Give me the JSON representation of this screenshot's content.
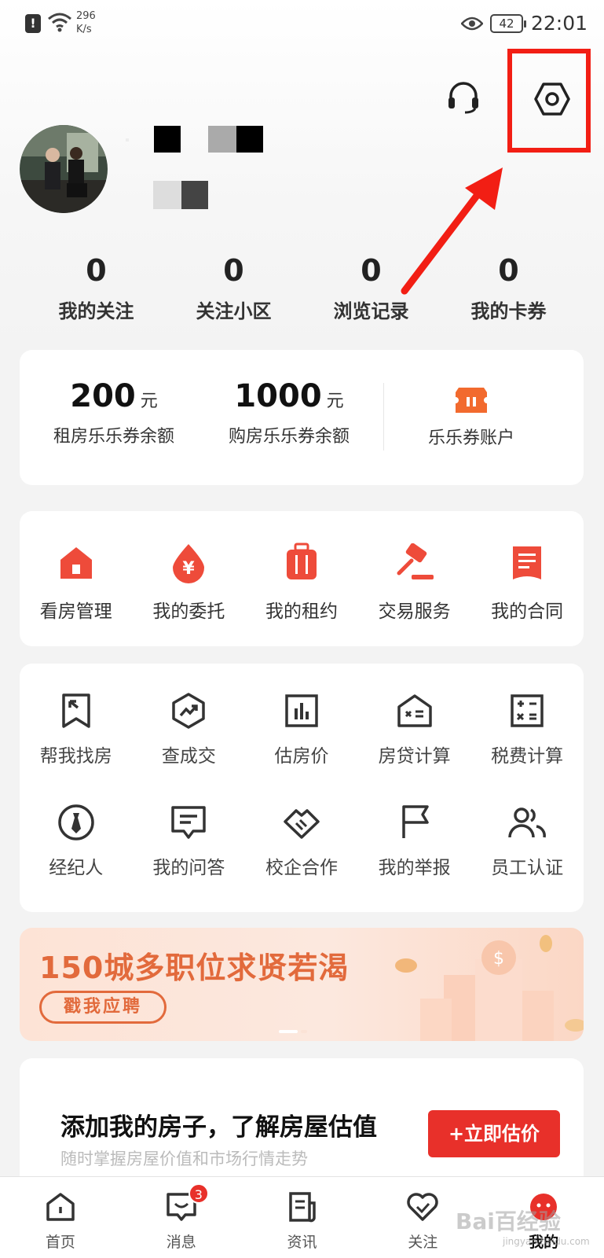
{
  "status_bar": {
    "network_speed": "296",
    "network_unit": "K/s",
    "battery": "42",
    "time": "22:01"
  },
  "header": {
    "support_icon": "headset-icon",
    "settings_icon": "hexagon-settings-icon"
  },
  "stats": [
    {
      "value": "0",
      "label": "我的关注"
    },
    {
      "value": "0",
      "label": "关注小区"
    },
    {
      "value": "0",
      "label": "浏览记录"
    },
    {
      "value": "0",
      "label": "我的卡券"
    }
  ],
  "coupons": {
    "rent": {
      "amount": "200",
      "unit": "元",
      "label": "租房乐乐券余额"
    },
    "buy": {
      "amount": "1000",
      "unit": "元",
      "label": "购房乐乐券余额"
    },
    "account": {
      "label": "乐乐券账户",
      "icon": "ticket-icon"
    }
  },
  "services": [
    {
      "label": "看房管理",
      "icon": "house-icon"
    },
    {
      "label": "我的委托",
      "icon": "yuan-drop-icon"
    },
    {
      "label": "我的租约",
      "icon": "luggage-icon"
    },
    {
      "label": "交易服务",
      "icon": "gavel-icon"
    },
    {
      "label": "我的合同",
      "icon": "contract-icon"
    }
  ],
  "tools": [
    {
      "label": "帮我找房",
      "icon": "flag-bookmark-icon"
    },
    {
      "label": "查成交",
      "icon": "trend-hexagon-icon"
    },
    {
      "label": "估房价",
      "icon": "bar-chart-icon"
    },
    {
      "label": "房贷计算",
      "icon": "house-calc-icon"
    },
    {
      "label": "税费计算",
      "icon": "calculator-icon"
    },
    {
      "label": "经纪人",
      "icon": "tie-icon"
    },
    {
      "label": "我的问答",
      "icon": "chat-icon"
    },
    {
      "label": "校企合作",
      "icon": "handshake-icon"
    },
    {
      "label": "我的举报",
      "icon": "flag-icon"
    },
    {
      "label": "员工认证",
      "icon": "people-icon"
    }
  ],
  "banner": {
    "title": "150城多职位求贤若渴",
    "button": "戳我应聘"
  },
  "estimate": {
    "title": "添加我的房子，了解房屋估值",
    "subtitle": "随时掌握房屋价值和市场行情走势",
    "button": "+立即估价"
  },
  "bottom_nav": [
    {
      "label": "首页",
      "icon": "home-icon"
    },
    {
      "label": "消息",
      "icon": "message-icon",
      "badge": "3"
    },
    {
      "label": "资讯",
      "icon": "news-icon"
    },
    {
      "label": "关注",
      "icon": "heart-check-icon"
    },
    {
      "label": "我的",
      "icon": "profile-face-icon",
      "active": true
    }
  ],
  "watermark": {
    "text": "Bai百经验",
    "sub": "jingyan.baidu.com"
  },
  "colors": {
    "accent": "#e8302a",
    "annotation": "#f21e14",
    "banner_text": "#e26a3c"
  }
}
